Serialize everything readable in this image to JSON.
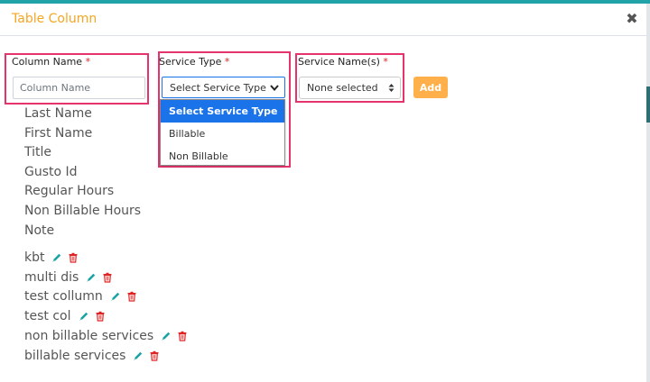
{
  "modal": {
    "title": "Table Column",
    "close_glyph": "✖"
  },
  "form": {
    "column_name": {
      "label": "Column Name",
      "required_mark": "*",
      "placeholder": "Column Name",
      "value": ""
    },
    "service_type": {
      "label": "Service Type",
      "required_mark": "*",
      "selected": "Select Service Type",
      "options": [
        "Select Service Type",
        "Billable",
        "Non Billable"
      ],
      "highlighted_index": 0
    },
    "service_names": {
      "label": "Service Name(s)",
      "required_mark": "*",
      "selected": "None selected"
    },
    "add_label": "Add"
  },
  "standard_columns": [
    "Last Name",
    "First Name",
    "Title",
    "Gusto Id",
    "Regular Hours",
    "Non Billable Hours",
    "Note"
  ],
  "custom_columns": [
    "kbt",
    "multi dis",
    "test collumn",
    "test col",
    "non billable services",
    "billable services"
  ],
  "icons": {
    "edit": "pencil-icon",
    "delete": "trash-icon"
  },
  "colors": {
    "accent": "#f5a623",
    "highlight_border": "#e5336b",
    "selected_option": "#1a73e8",
    "add_button": "#ffb04a",
    "edit_icon": "#1aa3a3",
    "delete_icon": "#e02424",
    "top_strip": "#21a3a8"
  }
}
